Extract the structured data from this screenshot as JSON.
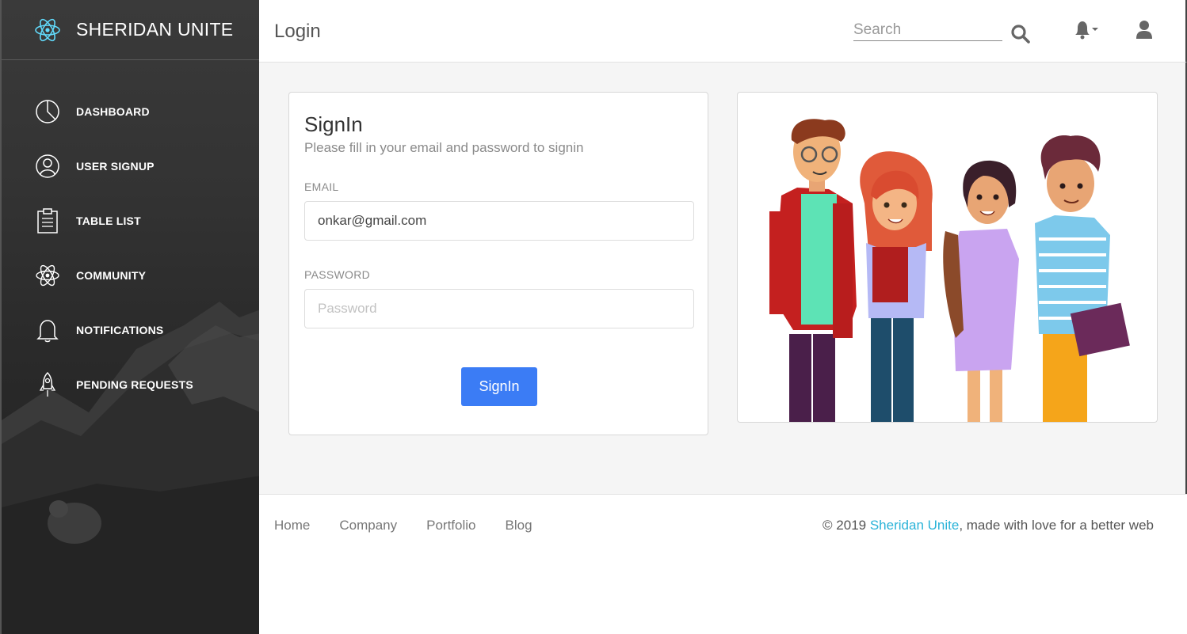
{
  "sidebar": {
    "brand": "SHERIDAN UNITE",
    "items": [
      {
        "label": "DASHBOARD",
        "icon": "pie-chart-icon"
      },
      {
        "label": "USER SIGNUP",
        "icon": "user-circle-icon"
      },
      {
        "label": "TABLE LIST",
        "icon": "clipboard-icon"
      },
      {
        "label": "COMMUNITY",
        "icon": "atom-icon"
      },
      {
        "label": "NOTIFICATIONS",
        "icon": "bell-icon"
      },
      {
        "label": "PENDING REQUESTS",
        "icon": "rocket-icon"
      }
    ]
  },
  "header": {
    "title": "Login",
    "search_placeholder": "Search"
  },
  "signin": {
    "title": "SignIn",
    "subtitle": "Please fill in your email and password to signin",
    "email_label": "EMAIL",
    "email_value": "onkar@gmail.com",
    "password_label": "PASSWORD",
    "password_placeholder": "Password",
    "button_label": "SignIn"
  },
  "footer": {
    "links": [
      "Home",
      "Company",
      "Portfolio",
      "Blog"
    ],
    "copyright_prefix": "© 2019 ",
    "copyright_brand": "Sheridan Unite",
    "copyright_suffix": ", made with love for a better web"
  },
  "colors": {
    "accent": "#3b7cf5",
    "brand_link": "#2ab3d8",
    "sidebar_bg": "#333333"
  }
}
